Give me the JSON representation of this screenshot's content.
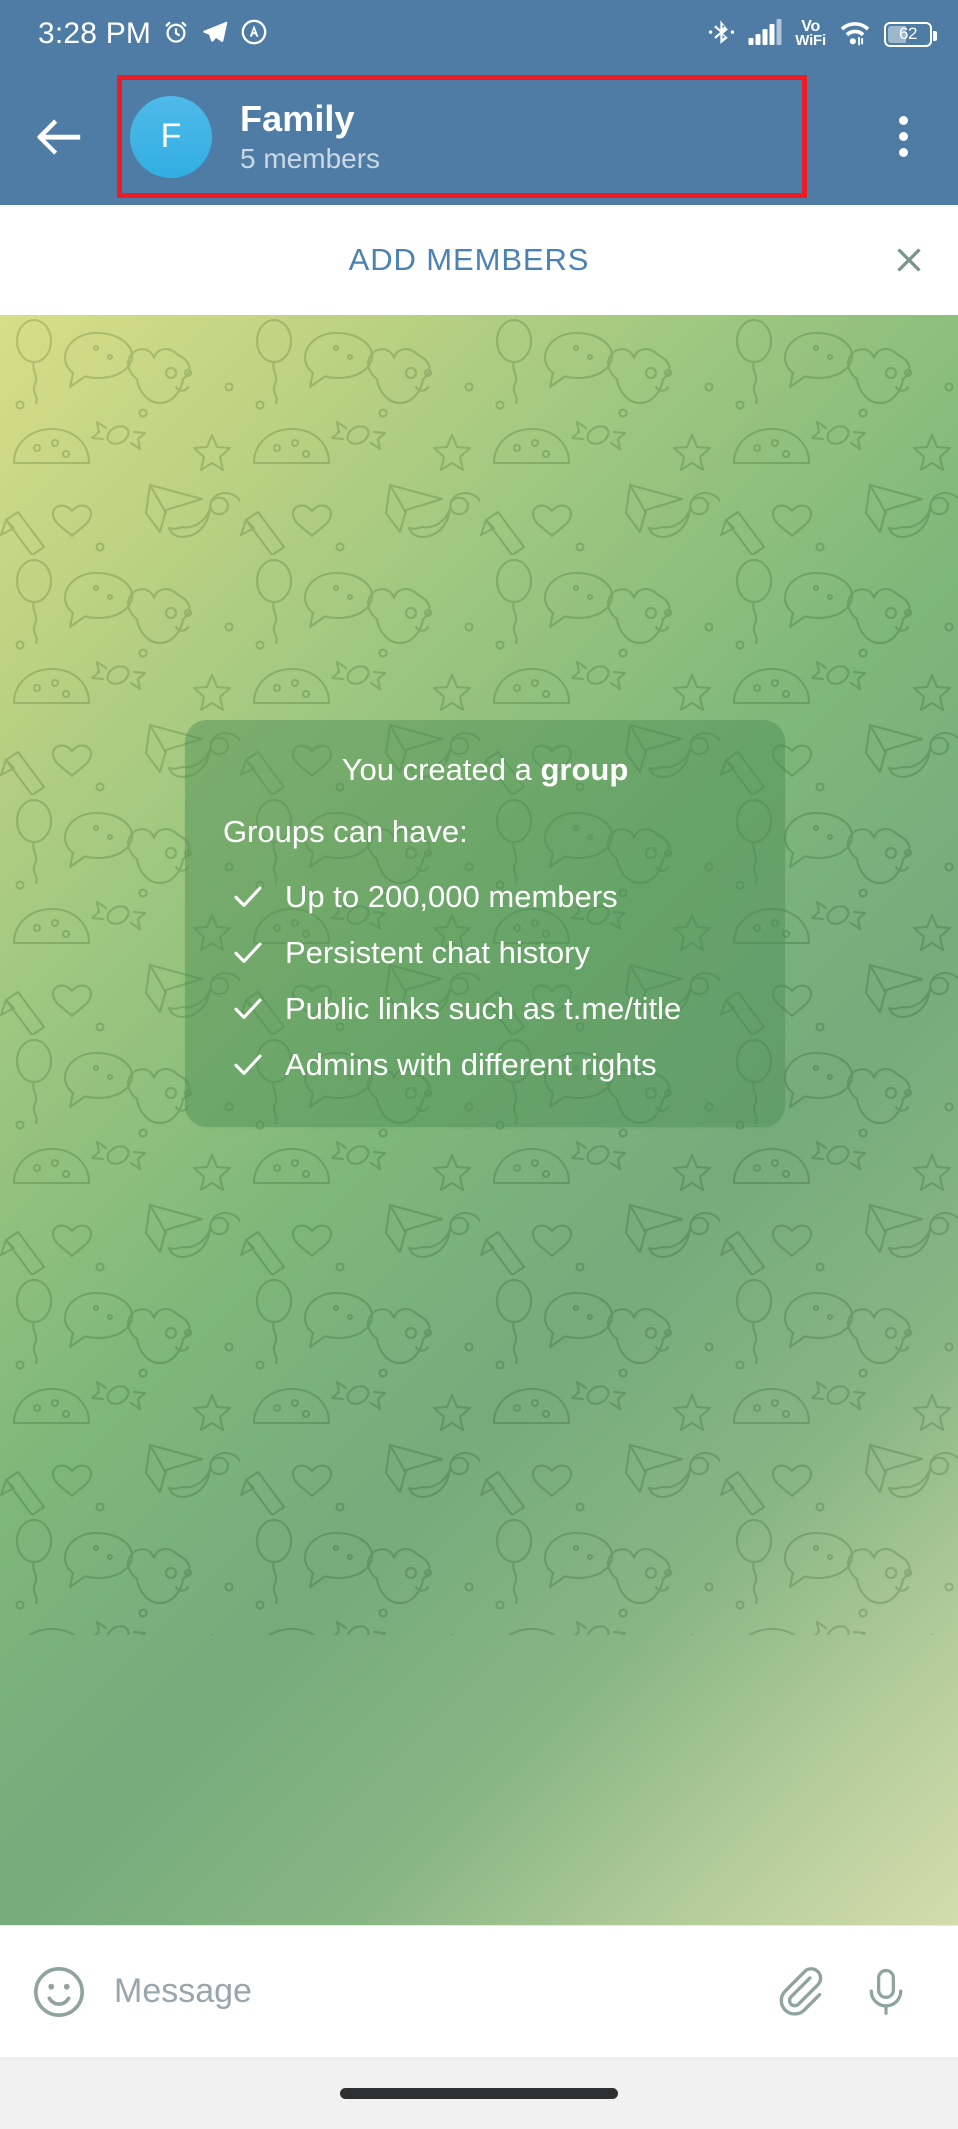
{
  "status_bar": {
    "time": "3:28 PM",
    "left_icons": [
      "alarm-icon",
      "telegram-send-icon",
      "adguard-icon"
    ],
    "right_icons": [
      "bluetooth-icon",
      "cellular-signal-icon",
      "vowifi-icon",
      "wifi-icon",
      "battery-icon"
    ],
    "vowifi_line1": "Vo",
    "vowifi_line2": "WiFi",
    "battery_level": "62",
    "background_color": "#4e7ca5"
  },
  "header": {
    "back_icon": "back-arrow-icon",
    "avatar_initial": "F",
    "avatar_color": "#32aee2",
    "title": "Family",
    "subtitle": "5 members",
    "menu_icon": "overflow-menu-icon",
    "highlight_color": "#ed1c24",
    "background_color": "#4e7ca5"
  },
  "add_members_bar": {
    "label": "ADD MEMBERS",
    "label_color": "#4a82b4",
    "close_icon": "close-icon"
  },
  "chat": {
    "wallpaper": "telegram-doodle-pattern",
    "card": {
      "title_prefix": "You created a ",
      "title_bold": "group",
      "subtitle": "Groups can have:",
      "features": [
        "Up to 200,000 members",
        "Persistent chat history",
        "Public links such as t.me/title",
        "Admins with different rights"
      ],
      "check_icon": "check-icon"
    }
  },
  "input_bar": {
    "emoji_icon": "emoji-smiley-icon",
    "placeholder": "Message",
    "value": "",
    "attach_icon": "paperclip-icon",
    "voice_icon": "microphone-icon"
  },
  "nav_bar": {
    "handle": "home-gesture-pill"
  }
}
